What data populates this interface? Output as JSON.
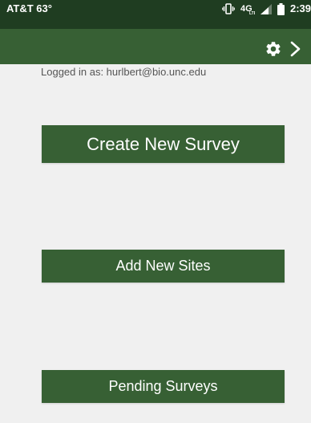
{
  "status_bar": {
    "carrier": "AT&T 63°",
    "clock": "2:39",
    "icons": [
      "vibrate-icon",
      "lte-signal-icon",
      "cell-signal-icon",
      "battery-icon"
    ]
  },
  "app_bar": {
    "settings_icon": "gear-icon",
    "next_icon": "chevron-right-icon",
    "color": "#376034"
  },
  "account": {
    "logged_in_text": "Logged in as: hurlbert@bio.unc.edu"
  },
  "actions": {
    "create_survey_label": "Create New Survey",
    "add_sites_label": "Add New Sites",
    "pending_surveys_label": "Pending Surveys"
  },
  "colors": {
    "status_bar": "#1f3d21",
    "primary": "#376034",
    "background": "#f0f0f0"
  }
}
